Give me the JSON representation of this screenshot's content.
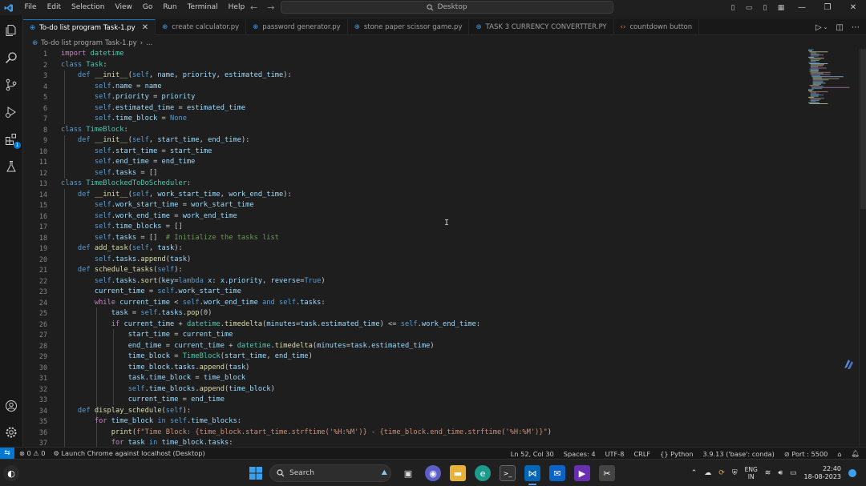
{
  "titlebar": {
    "menu": [
      "File",
      "Edit",
      "Selection",
      "View",
      "Go",
      "Run",
      "Terminal",
      "Help"
    ],
    "search_text": "Desktop"
  },
  "tabs": [
    {
      "label": "To-do list program Task-1.py",
      "active": true
    },
    {
      "label": "create calculator.py",
      "active": false
    },
    {
      "label": "password generator.py",
      "active": false
    },
    {
      "label": "stone paper scissor game.py",
      "active": false
    },
    {
      "label": "TASK 3 CURRENCY CONVERTTER.PY",
      "active": false
    },
    {
      "label": "countdown button",
      "active": false
    }
  ],
  "breadcrumb": {
    "file": "To-do list program Task-1.py",
    "rest": "..."
  },
  "editor": {
    "line_numbers": [
      "1",
      "2",
      "3",
      "4",
      "5",
      "6",
      "7",
      "8",
      "9",
      "10",
      "11",
      "12",
      "13",
      "14",
      "15",
      "16",
      "17",
      "18",
      "19",
      "20",
      "21",
      "22",
      "23",
      "24",
      "25",
      "26",
      "27",
      "28",
      "29",
      "30",
      "31",
      "32",
      "33",
      "34",
      "35",
      "36",
      "37"
    ],
    "lines": [
      "import datetime",
      "class Task:",
      "    def __init__(self, name, priority, estimated_time):",
      "        self.name = name",
      "        self.priority = priority",
      "        self.estimated_time = estimated_time",
      "        self.time_block = None",
      "class TimeBlock:",
      "    def __init__(self, start_time, end_time):",
      "        self.start_time = start_time",
      "        self.end_time = end_time",
      "        self.tasks = []",
      "class TimeBlockedToDoScheduler:",
      "    def __init__(self, work_start_time, work_end_time):",
      "        self.work_start_time = work_start_time",
      "        self.work_end_time = work_end_time",
      "        self.time_blocks = []",
      "        self.tasks = []  # Initialize the tasks list",
      "    def add_task(self, task):",
      "        self.tasks.append(task)",
      "    def schedule_tasks(self):",
      "        self.tasks.sort(key=lambda x: x.priority, reverse=True)",
      "        current_time = self.work_start_time",
      "        while current_time < self.work_end_time and self.tasks:",
      "            task = self.tasks.pop(0)",
      "            if current_time + datetime.timedelta(minutes=task.estimated_time) <= self.work_end_time:",
      "                start_time = current_time",
      "                end_time = current_time + datetime.timedelta(minutes=task.estimated_time)",
      "                time_block = TimeBlock(start_time, end_time)",
      "                time_block.tasks.append(task)",
      "                task.time_block = time_block",
      "                self.time_blocks.append(time_block)",
      "                current_time = end_time",
      "    def display_schedule(self):",
      "        for time_block in self.time_blocks:",
      "            print(f\"Time Block: {time_block.start_time.strftime('%H:%M')} - {time_block.end_time.strftime('%H:%M')}\")",
      "            for task in time_block.tasks:"
    ]
  },
  "statusbar": {
    "errors": "0",
    "warnings": "0",
    "launch": "Launch Chrome against localhost (Desktop)",
    "position": "Ln 52, Col 30",
    "spaces": "Spaces: 4",
    "encoding": "UTF-8",
    "eol": "CRLF",
    "language": "Python",
    "interpreter": "3.9.13 ('base': conda)",
    "port": "Port : 5500"
  },
  "taskbar": {
    "search": "Search",
    "lang_1": "ENG",
    "lang_2": "IN",
    "time": "22:40",
    "date": "18-08-2023"
  },
  "colors": {
    "accent": "#0078d4",
    "keyword": "#569cd6",
    "class": "#4ec9b0",
    "function": "#dcdcaa",
    "variable": "#9cdcfe",
    "string": "#ce9178",
    "comment": "#6a9955"
  }
}
